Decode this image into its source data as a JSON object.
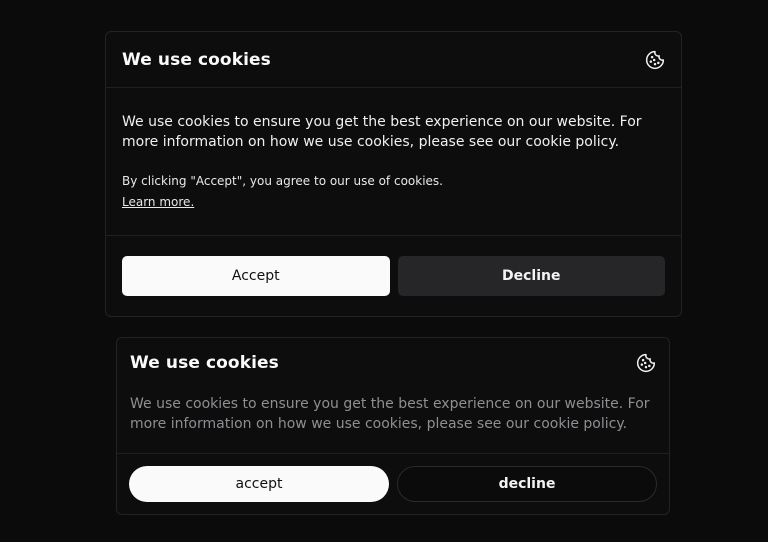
{
  "banner_primary": {
    "title": "We use cookies",
    "icon": "cookie-icon",
    "message": "We use cookies to ensure you get the best experience on our website. For more information on how we use cookies, please see our cookie policy.",
    "consent_text": "By clicking \"Accept\", you agree to our use of cookies.",
    "learn_more_label": "Learn more.",
    "accept_label": "Accept",
    "decline_label": "Decline"
  },
  "banner_secondary": {
    "title": "We use cookies",
    "icon": "cookie-icon",
    "message": "We use cookies to ensure you get the best experience on our website. For more information on how we use cookies, please see our cookie policy.",
    "accept_label": "accept",
    "decline_label": "decline"
  },
  "colors": {
    "background": "#0b0b0c",
    "card_border": "#232325",
    "accept_button": "#fafafa",
    "decline_button": "#262628",
    "muted_text": "#8f8f93"
  }
}
